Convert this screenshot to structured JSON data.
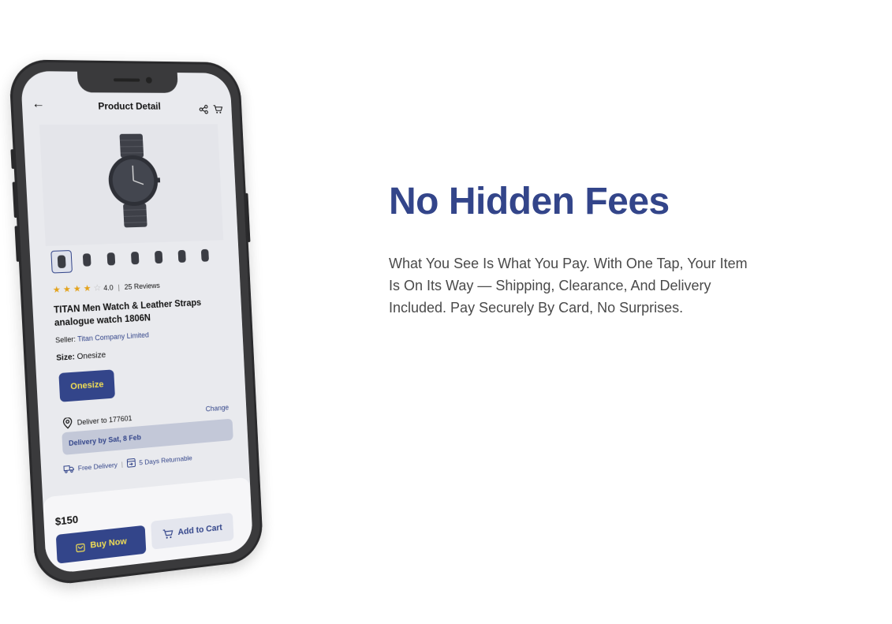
{
  "app": {
    "title": "Product Detail"
  },
  "product": {
    "rating": "4.0",
    "reviews": "25 Reviews",
    "name": "TITAN Men Watch & Leather Straps analogue watch 1806N",
    "seller_label": "Seller:",
    "seller_name": "Titan Company Limited",
    "size_label": "Size:",
    "size_value": "Onesize",
    "size_option": "Onesize",
    "thumbnail_count": 7
  },
  "delivery": {
    "deliver_to": "Deliver to 177601",
    "change_label": "Change",
    "delivery_date": "Delivery by Sat, 8 Feb",
    "free_delivery": "Free Delivery",
    "returnable": "5 Days Returnable"
  },
  "checkout": {
    "price": "$150",
    "buy_now": "Buy Now",
    "add_to_cart": "Add to Cart"
  },
  "marketing": {
    "headline": "No Hidden Fees",
    "body": "What You See Is What You Pay. With One Tap, Your Item Is On Its Way — Shipping, Clearance, And Delivery Included. Pay Securely By Card, No Surprises."
  },
  "colors": {
    "brand": "#33458a",
    "accent": "#f1de55",
    "star": "#e3a21a",
    "phone_body": "#3a3a3c"
  }
}
